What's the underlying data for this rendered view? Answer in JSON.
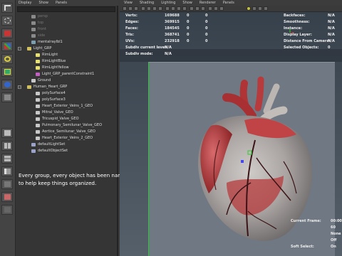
{
  "outliner": {
    "menu": [
      "Display",
      "Show",
      "Panels"
    ],
    "items": [
      {
        "label": "persp",
        "depth": 1,
        "kind": "camera",
        "dim": true
      },
      {
        "label": "top",
        "depth": 1,
        "kind": "camera",
        "dim": true
      },
      {
        "label": "front",
        "depth": 1,
        "kind": "camera",
        "dim": true
      },
      {
        "label": "side",
        "depth": 1,
        "kind": "camera",
        "dim": true
      },
      {
        "label": "mentalrayIbl1",
        "depth": 1,
        "kind": "ibl",
        "dim": false
      },
      {
        "label": "Light_GRP",
        "depth": 0,
        "kind": "group",
        "dim": false
      },
      {
        "label": "RimLight",
        "depth": 2,
        "kind": "light",
        "dim": false
      },
      {
        "label": "RimLightBlue",
        "depth": 2,
        "kind": "light",
        "dim": false
      },
      {
        "label": "RimLightYellow",
        "depth": 2,
        "kind": "light",
        "dim": false
      },
      {
        "label": "Light_GRP_parentConstraint1",
        "depth": 2,
        "kind": "constraint",
        "dim": false
      },
      {
        "label": "Ground",
        "depth": 1,
        "kind": "mesh",
        "dim": false
      },
      {
        "label": "Human_Heart_GRP",
        "depth": 0,
        "kind": "group",
        "dim": false
      },
      {
        "label": "polySurface4",
        "depth": 2,
        "kind": "mesh",
        "dim": false
      },
      {
        "label": "polySurface3",
        "depth": 2,
        "kind": "mesh",
        "dim": false
      },
      {
        "label": "Heart_Exterior_Veins_1_GEO",
        "depth": 2,
        "kind": "mesh",
        "dim": false
      },
      {
        "label": "Mitral_Valve_GEO",
        "depth": 2,
        "kind": "mesh",
        "dim": false
      },
      {
        "label": "Tricuspid_Valve_GEO",
        "depth": 2,
        "kind": "mesh",
        "dim": false
      },
      {
        "label": "Pulmonary_Semilunar_Valve_GEO",
        "depth": 2,
        "kind": "mesh",
        "dim": false
      },
      {
        "label": "Aortice_Semilunar_Valve_GEO",
        "depth": 2,
        "kind": "mesh",
        "dim": false
      },
      {
        "label": "Heart_Exterior_Veins_2_GEO",
        "depth": 2,
        "kind": "mesh",
        "dim": false
      },
      {
        "label": "defaultLightSet",
        "depth": 1,
        "kind": "set",
        "dim": false
      },
      {
        "label": "defaultObjectSet",
        "depth": 1,
        "kind": "set",
        "dim": false
      }
    ],
    "caption": "Every group, every object has been named to help keep things organized."
  },
  "viewport": {
    "menu": [
      "View",
      "Shading",
      "Lighting",
      "Show",
      "Renderer",
      "Panels"
    ],
    "resolution": "1280 x 1280",
    "hud_left": [
      {
        "label": "Verts:",
        "v1": "169688",
        "v2": "0",
        "v3": "0"
      },
      {
        "label": "Edges:",
        "v1": "369915",
        "v2": "0",
        "v3": "0"
      },
      {
        "label": "Faces:",
        "v1": "184545",
        "v2": "0",
        "v3": "0"
      },
      {
        "label": "Tris:",
        "v1": "368741",
        "v2": "0",
        "v3": "0"
      },
      {
        "label": "UVs:",
        "v1": "232918",
        "v2": "0",
        "v3": "0"
      },
      {
        "label": "Subdiv current level:",
        "v1": "N/A",
        "v2": "",
        "v3": ""
      },
      {
        "label": "Subdiv mode:",
        "v1": "N/A",
        "v2": "",
        "v3": ""
      }
    ],
    "hud_right": [
      {
        "label": "Backfaces:",
        "value": "N/A"
      },
      {
        "label": "Smoothness:",
        "value": "N/A"
      },
      {
        "label": "Instance:",
        "value": "N/A"
      },
      {
        "label": "Display Layer:",
        "value": "N/A"
      },
      {
        "label": "Distance From Camera:",
        "value": "N/A"
      },
      {
        "label": "Selected Objects:",
        "value": "0"
      }
    ],
    "hud_bottom": [
      {
        "label": "Current Frame:",
        "value": "00:00:"
      },
      {
        "label": "",
        "value": "60"
      },
      {
        "label": "",
        "value": "None"
      },
      {
        "label": "",
        "value": "Off"
      },
      {
        "label": "Soft Select:",
        "value": "On"
      }
    ]
  },
  "colors": {
    "heart_red": "#b83a3c",
    "heart_grey": "#b9b6b4",
    "viewport_bg": "#414a55",
    "gate_green": "#22cc33"
  }
}
